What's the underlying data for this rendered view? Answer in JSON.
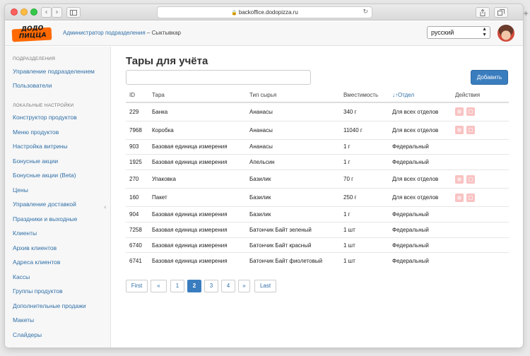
{
  "browser": {
    "url": "backoffice.dodopizza.ru",
    "back_glyph": "‹",
    "forward_glyph": "›",
    "new_tab_glyph": "+"
  },
  "header": {
    "logo_line1": "ДОДО",
    "logo_line2": "ПИЦЦА",
    "unit_name": "Администратор подразделения",
    "unit_separator": " – ",
    "unit_city": "Сыктывкар",
    "language": "русский"
  },
  "sidebar": {
    "section1": "ПОДРАЗДЕЛЕНИЯ",
    "section1_items": [
      "Управление подразделением",
      "Пользователи"
    ],
    "section2": "ЛОКАЛЬНЫЕ НАСТРОЙКИ",
    "section2_items": [
      "Конструктор продуктов",
      "Меню продуктов",
      "Настройка витрины",
      "Бонусные акции",
      "Бонусные акции (Beta)",
      "Цены",
      "Управление доставкой",
      "Праздники и выходные",
      "Клиенты",
      "Архив клиентов",
      "Адреса клиентов",
      "Кассы",
      "Группы продуктов",
      "Дополнительные продажи",
      "Макеты",
      "Слайдеры"
    ]
  },
  "main": {
    "title": "Тары для учёта",
    "search_placeholder": "",
    "add_button": "Добавить",
    "columns": [
      "ID",
      "Тара",
      "Тип сырья",
      "Вместимость",
      "↓↑Отдел",
      "Действия"
    ],
    "rows": [
      {
        "id": "229",
        "tare": "Банка",
        "type": "Ананасы",
        "capacity": "340 г",
        "dept": "Для всех отделов",
        "actions": true
      },
      {
        "id": "7968",
        "tare": "Коробка",
        "type": "Ананасы",
        "capacity": "11040 г",
        "dept": "Для всех отделов",
        "actions": true
      },
      {
        "id": "903",
        "tare": "Базовая единица измерения",
        "type": "Ананасы",
        "capacity": "1 г",
        "dept": "Федеральный",
        "actions": false
      },
      {
        "id": "1925",
        "tare": "Базовая единица измерения",
        "type": "Апельсин",
        "capacity": "1 г",
        "dept": "Федеральный",
        "actions": false
      },
      {
        "id": "270",
        "tare": "Упаковка",
        "type": "Базилик",
        "capacity": "70 г",
        "dept": "Для всех отделов",
        "actions": true
      },
      {
        "id": "160",
        "tare": "Пакет",
        "type": "Базилик",
        "capacity": "250 г",
        "dept": "Для всех отделов",
        "actions": true
      },
      {
        "id": "904",
        "tare": "Базовая единица измерения",
        "type": "Базилик",
        "capacity": "1 г",
        "dept": "Федеральный",
        "actions": false
      },
      {
        "id": "7258",
        "tare": "Базовая единица измерения",
        "type": "Батончик Байт зеленый",
        "capacity": "1 шт",
        "dept": "Федеральный",
        "actions": false
      },
      {
        "id": "6740",
        "tare": "Базовая единица измерения",
        "type": "Батончик Байт красный",
        "capacity": "1 шт",
        "dept": "Федеральный",
        "actions": false
      },
      {
        "id": "6741",
        "tare": "Базовая единица измерения",
        "type": "Батончик Байт фиолетовый",
        "capacity": "1 шт",
        "dept": "Федеральный",
        "actions": false
      }
    ],
    "pagination": {
      "first": "First",
      "prev": "«",
      "pages": [
        "1",
        "2",
        "3",
        "4"
      ],
      "current": "2",
      "next": "»",
      "last": "Last"
    }
  }
}
